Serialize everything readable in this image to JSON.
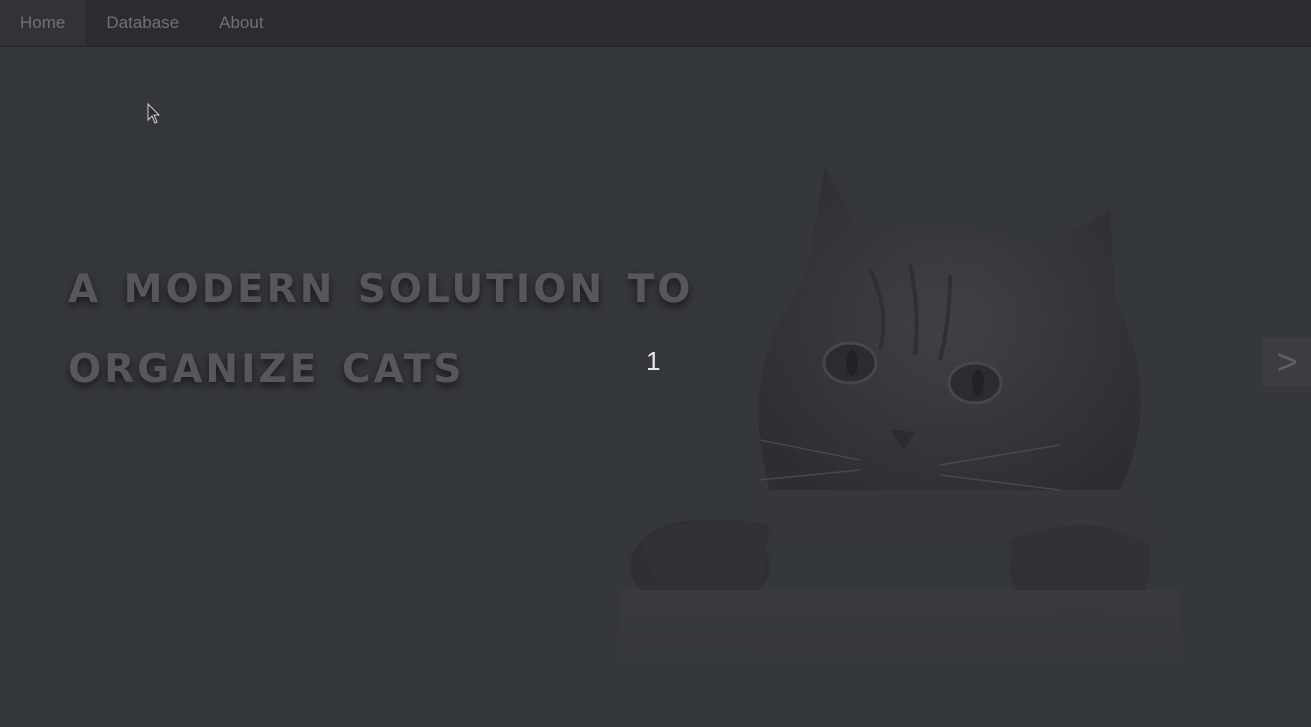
{
  "nav": {
    "items": [
      {
        "label": "Home",
        "active": true
      },
      {
        "label": "Database",
        "active": false
      },
      {
        "label": "About",
        "active": false
      }
    ]
  },
  "hero": {
    "headline_line1": "A MODERN SOLUTION TO",
    "headline_line2": "ORGANIZE CATS",
    "slide_number": "1",
    "next_label": ">",
    "image": "cat-peeking-photo"
  },
  "colors": {
    "background": "#34373c",
    "navbar": "#2b2c2f",
    "headline": "#55575b"
  }
}
